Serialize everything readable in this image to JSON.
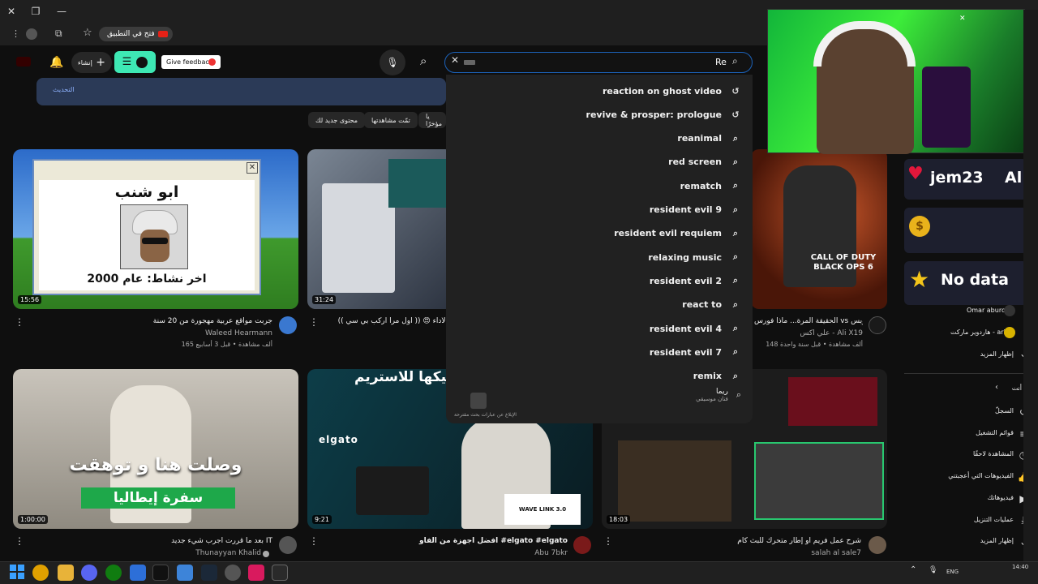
{
  "browser": {
    "open_in_app": "فتح في التطبيق"
  },
  "header": {
    "give_feedback": "Give feedback",
    "create_label": "إنشاء",
    "search_value": "Re"
  },
  "banner": {
    "text": "التحديث"
  },
  "chips": [
    "محتوى جديد لك",
    "تمّت مشاهدتها",
    "يا مؤخرًا"
  ],
  "suggestions": [
    {
      "text": "reaction on ghost video",
      "icon": "history-icon"
    },
    {
      "text": "revive & prosper: prologue",
      "icon": "history-icon"
    },
    {
      "text": "reanimal",
      "icon": "search-icon"
    },
    {
      "text": "red screen",
      "icon": "search-icon"
    },
    {
      "text": "rematch",
      "icon": "search-icon"
    },
    {
      "text": "resident evil 9",
      "icon": "search-icon"
    },
    {
      "text": "resident evil requiem",
      "icon": "search-icon"
    },
    {
      "text": "relaxing music",
      "icon": "search-icon"
    },
    {
      "text": "resident evil 2",
      "icon": "search-icon"
    },
    {
      "text": "react to",
      "icon": "search-icon"
    },
    {
      "text": "resident evil 4",
      "icon": "search-icon"
    },
    {
      "text": "resident evil 7",
      "icon": "search-icon"
    },
    {
      "text": "remix",
      "icon": "search-icon"
    }
  ],
  "suggestion_channel": {
    "name": "ريما",
    "sub": "فنان موسيقي"
  },
  "report_text": "الإبلاغ عن عبارات بحث مقترحة",
  "videos": [
    {
      "duration": "15:56",
      "title": "جربت مواقع عربية مهجورة من 20 سنة",
      "channel": "Waleed Hearmann",
      "meta": "165 ألف مشاهدة • قبل 3 أسابيع",
      "thumb_title": "ابو شنب",
      "thumb_sub": "اخر نشاط: عام 2000"
    },
    {
      "duration": "31:24",
      "title": "(( أول مرا اركب بي سي )) 😍 الأداء",
      "channel": "",
      "meta": ""
    },
    {
      "duration": "",
      "title": "الحقيقة المرة... ماذا فورس vs بلاك أوبس",
      "channel": "علي اكس - Ali X19",
      "meta": "148 ألف مشاهدة • قبل سنة واحدة",
      "thumb_title": "CALL OF DUTY BLACK OPS 6"
    },
    {
      "duration": "1:00:00",
      "title": "بعد ما قررت أجرب شيء جديد IT",
      "channel": "Thunayyan Khalid",
      "meta": "",
      "thumb_title": "وصلت هنا و توهقت",
      "thumb_sub": "سفرة إيطاليا"
    },
    {
      "duration": "9:21",
      "title": "افضل اجهزة من الفاو #elgato #elgato",
      "channel": "Abu 7bkr",
      "meta": "",
      "thumb_title": "بيكها للاستريم",
      "thumb_brand": "elgato",
      "thumb_wave": "WAVE LINK 3.0"
    },
    {
      "duration": "18:03",
      "title": "شرح عمل فريم او إطار متحرك للبث كام",
      "channel": "salah al sale7",
      "meta": ""
    }
  ],
  "sidebar": {
    "subs": [
      {
        "label": "Omar aburobb"
      },
      {
        "label": "هاردوير ماركت - arket"
      },
      {
        "label": "إظهار المزيد"
      }
    ],
    "you_label": "أنت",
    "items": [
      {
        "label": "السجلّ",
        "icon": "history-icon"
      },
      {
        "label": "قوائم التشغيل",
        "icon": "playlist-icon"
      },
      {
        "label": "المشاهدة لاحقًا",
        "icon": "clock-icon"
      },
      {
        "label": "الفيديوهات التي أعجبتني",
        "icon": "like-icon"
      },
      {
        "label": "فيديوهاتك",
        "icon": "video-icon"
      },
      {
        "label": "عمليات التنزيل",
        "icon": "download-icon"
      },
      {
        "label": "إظهار المزيد",
        "icon": "chevron-down-icon"
      }
    ]
  },
  "overlay": {
    "panel1": "jem23",
    "panel1_right": "Al",
    "panel3": "No data"
  },
  "taskbar": {
    "lang": "ENG",
    "time": "14:40"
  }
}
